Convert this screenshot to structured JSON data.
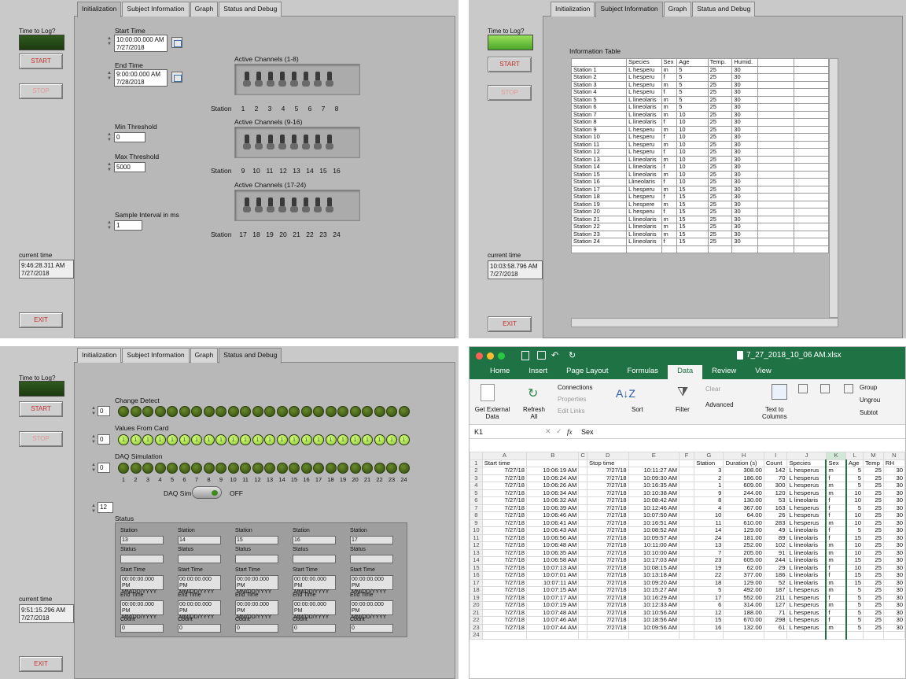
{
  "tabs": [
    "Initialization",
    "Subject Information",
    "Graph",
    "Status and Debug"
  ],
  "left": {
    "time_to_log": "Time to Log?",
    "start": "START",
    "stop": "STOP",
    "exit": "EXIT",
    "current_time_label": "current time"
  },
  "panel1": {
    "current_time": "9:46:28.311 AM\n7/27/2018",
    "start_time_label": "Start Time",
    "start_time": "10:00:00.000 AM\n7/27/2018",
    "end_time_label": "End Time",
    "end_time": "9:00:00.000 AM\n7/28/2018",
    "min_threshold_label": "Min Threshold",
    "min_threshold": "0",
    "max_threshold_label": "Max Threshold",
    "max_threshold": "5000",
    "sample_interval_label": "Sample Interval in ms",
    "sample_interval": "1",
    "channels": [
      {
        "label": "Active Channels (1-8)",
        "stations": [
          "Station",
          "1",
          "2",
          "3",
          "4",
          "5",
          "6",
          "7",
          "8"
        ]
      },
      {
        "label": "Active Channels (9-16)",
        "stations": [
          "Station",
          "9",
          "10",
          "11",
          "12",
          "13",
          "14",
          "15",
          "16"
        ]
      },
      {
        "label": "Active Channels (17-24)",
        "stations": [
          "Station",
          "17",
          "18",
          "19",
          "20",
          "21",
          "22",
          "23",
          "24"
        ]
      }
    ]
  },
  "panel2": {
    "current_time": "10:03:58.796 AM\n7/27/2018",
    "table_label": "Information Table",
    "headers": [
      "",
      "Species",
      "Sex",
      "Age",
      "Temp.",
      "Humid.",
      "",
      ""
    ],
    "rows": [
      [
        "Station 1",
        "L hesperu",
        "m",
        "5",
        "25",
        "30"
      ],
      [
        "Station 2",
        "L hesperu",
        "f",
        "5",
        "25",
        "30"
      ],
      [
        "Station 3",
        "L hesperu",
        "m",
        "5",
        "25",
        "30"
      ],
      [
        "Station 4",
        "L hesperu",
        "f",
        "5",
        "25",
        "30"
      ],
      [
        "Station 5",
        "L lineolaris",
        "m",
        "5",
        "25",
        "30"
      ],
      [
        "Station 6",
        "L lineolaris",
        "m",
        "5",
        "25",
        "30"
      ],
      [
        "Station 7",
        "L lineolaris",
        "m",
        "10",
        "25",
        "30"
      ],
      [
        "Station 8",
        "L lineolaris",
        "f",
        "10",
        "25",
        "30"
      ],
      [
        "Station 9",
        "L hesperu",
        "m",
        "10",
        "25",
        "30"
      ],
      [
        "Station 10",
        "L hesperu",
        "f",
        "10",
        "25",
        "30"
      ],
      [
        "Station 11",
        "L hesperu",
        "m",
        "10",
        "25",
        "30"
      ],
      [
        "Station 12",
        "L hesperu",
        "f",
        "10",
        "25",
        "30"
      ],
      [
        "Station 13",
        "L lineolaris",
        "m",
        "10",
        "25",
        "30"
      ],
      [
        "Station 14",
        "L lineolaris",
        "f",
        "10",
        "25",
        "30"
      ],
      [
        "Station 15",
        "L lineolaris",
        "m",
        "10",
        "25",
        "30"
      ],
      [
        "Station 16",
        "Llineolaris",
        "f",
        "10",
        "25",
        "30"
      ],
      [
        "Station 17",
        "L hesperu",
        "m",
        "15",
        "25",
        "30"
      ],
      [
        "Station 18",
        "L hesperu",
        "f",
        "15",
        "25",
        "30"
      ],
      [
        "Station 19",
        "L hespere",
        "m",
        "15",
        "25",
        "30"
      ],
      [
        "Station 20",
        "L hesperu",
        "f",
        "15",
        "25",
        "30"
      ],
      [
        "Station 21",
        "L lineolaris",
        "m",
        "15",
        "25",
        "30"
      ],
      [
        "Station 22",
        "L lineolaris",
        "m",
        "15",
        "25",
        "30"
      ],
      [
        "Station 23",
        "L lineolaris",
        "m",
        "15",
        "25",
        "30"
      ],
      [
        "Station 24",
        "L lineolaris",
        "f",
        "15",
        "25",
        "30"
      ]
    ]
  },
  "panel3": {
    "current_time": "9:51:15.296 AM\n7/27/2018",
    "change_detect_label": "Change Detect",
    "change_detect_value": "0",
    "values_from_card_label": "Values From Card",
    "values_from_card_value": "0",
    "daq_sim_label": "DAQ Simulation",
    "daq_sim_value": "0",
    "led_numbers": [
      "1",
      "2",
      "3",
      "4",
      "5",
      "6",
      "7",
      "8",
      "9",
      "10",
      "11",
      "12",
      "13",
      "14",
      "15",
      "16",
      "17",
      "18",
      "19",
      "20",
      "21",
      "22",
      "23",
      "24"
    ],
    "daq_sim_toggle_label": "DAQ Sim",
    "daq_sim_toggle_state": "OFF",
    "status_index": "12",
    "status_label": "Status",
    "station_label": "Station",
    "station_status_label": "Status",
    "start_time_label": "Start Time",
    "end_time_label": "End Time",
    "count_label": "Count",
    "time_value": "00:00:00.000 PM\nMM/DD/YYYY",
    "count_value": "0",
    "stations": [
      "13",
      "14",
      "15",
      "16",
      "17"
    ]
  },
  "excel": {
    "filename": "7_27_2018_10_06 AM.xlsx",
    "tabs": [
      "Home",
      "Insert",
      "Page Layout",
      "Formulas",
      "Data",
      "Review",
      "View"
    ],
    "active_tab": "Data",
    "ribbon": {
      "get_external": "Get External\nData",
      "refresh": "Refresh\nAll",
      "connections": "Connections",
      "properties": "Properties",
      "edit_links": "Edit Links",
      "sort": "Sort",
      "filter": "Filter",
      "clear": "Clear",
      "advanced": "Advanced",
      "text_to_columns": "Text to\nColumns",
      "group": "Group",
      "ungroup": "Ungrou",
      "subtotal": "Subtot"
    },
    "name_box": "K1",
    "formula": "Sex",
    "fx": "fx",
    "columns": [
      "",
      "A",
      "B",
      "C",
      "D",
      "E",
      "F",
      "G",
      "H",
      "I",
      "J",
      "K",
      "L",
      "M",
      "N"
    ],
    "header_row": [
      "Start time",
      "",
      "",
      "Stop time",
      "",
      "",
      "Station",
      "Duration (s)",
      "Count",
      "Species",
      "Sex",
      "Age",
      "Temp",
      "RH"
    ],
    "rows": [
      [
        "7/27/18",
        "10:06:19 AM",
        "",
        "7/27/18",
        "10:11:27 AM",
        "",
        "3",
        "308.00",
        "142",
        "L hesperus",
        "m",
        "5",
        "25",
        "30"
      ],
      [
        "7/27/18",
        "10:06:24 AM",
        "",
        "7/27/18",
        "10:09:30 AM",
        "",
        "2",
        "186.00",
        "70",
        "L hesperus",
        "f",
        "5",
        "25",
        "30"
      ],
      [
        "7/27/18",
        "10:06:26 AM",
        "",
        "7/27/18",
        "10:16:35 AM",
        "",
        "1",
        "609.00",
        "300",
        "L hesperus",
        "m",
        "5",
        "25",
        "30"
      ],
      [
        "7/27/18",
        "10:06:34 AM",
        "",
        "7/27/18",
        "10:10:38 AM",
        "",
        "9",
        "244.00",
        "120",
        "L hesperus",
        "m",
        "10",
        "25",
        "30"
      ],
      [
        "7/27/18",
        "10:06:32 AM",
        "",
        "7/27/18",
        "10:08:42 AM",
        "",
        "8",
        "130.00",
        "53",
        "L lineolaris",
        "f",
        "10",
        "25",
        "30"
      ],
      [
        "7/27/18",
        "10:06:39 AM",
        "",
        "7/27/18",
        "10:12:46 AM",
        "",
        "4",
        "367.00",
        "163",
        "L hesperus",
        "f",
        "5",
        "25",
        "30"
      ],
      [
        "7/27/18",
        "10:06:46 AM",
        "",
        "7/27/18",
        "10:07:50 AM",
        "",
        "10",
        "64.00",
        "26",
        "L hesperus",
        "f",
        "10",
        "25",
        "30"
      ],
      [
        "7/27/18",
        "10:06:41 AM",
        "",
        "7/27/18",
        "10:16:51 AM",
        "",
        "11",
        "610.00",
        "283",
        "L hesperus",
        "m",
        "10",
        "25",
        "30"
      ],
      [
        "7/27/18",
        "10:06:43 AM",
        "",
        "7/27/18",
        "10:08:52 AM",
        "",
        "14",
        "129.00",
        "49",
        "L lineolaris",
        "f",
        "5",
        "25",
        "30"
      ],
      [
        "7/27/18",
        "10:06:56 AM",
        "",
        "7/27/18",
        "10:09:57 AM",
        "",
        "24",
        "181.00",
        "89",
        "L lineolaris",
        "f",
        "15",
        "25",
        "30"
      ],
      [
        "7/27/18",
        "10:06:48 AM",
        "",
        "7/27/18",
        "10:11:00 AM",
        "",
        "13",
        "252.00",
        "102",
        "L lineolaris",
        "m",
        "10",
        "25",
        "30"
      ],
      [
        "7/27/18",
        "10:06:35 AM",
        "",
        "7/27/18",
        "10:10:00 AM",
        "",
        "7",
        "205.00",
        "91",
        "L lineolaris",
        "m",
        "10",
        "25",
        "30"
      ],
      [
        "7/27/18",
        "10:06:58 AM",
        "",
        "7/27/18",
        "10:17:03 AM",
        "",
        "23",
        "605.00",
        "244",
        "L lineolaris",
        "m",
        "15",
        "25",
        "30"
      ],
      [
        "7/27/18",
        "10:07:13 AM",
        "",
        "7/27/18",
        "10:08:15 AM",
        "",
        "19",
        "62.00",
        "29",
        "L lineolaris",
        "f",
        "10",
        "25",
        "30"
      ],
      [
        "7/27/18",
        "10:07:01 AM",
        "",
        "7/27/18",
        "10:13:18 AM",
        "",
        "22",
        "377.00",
        "186",
        "L lineolaris",
        "f",
        "15",
        "25",
        "30"
      ],
      [
        "7/27/18",
        "10:07:11 AM",
        "",
        "7/27/18",
        "10:09:20 AM",
        "",
        "18",
        "129.00",
        "52",
        "L lineolaris",
        "m",
        "15",
        "25",
        "30"
      ],
      [
        "7/27/18",
        "10:07:15 AM",
        "",
        "7/27/18",
        "10:15:27 AM",
        "",
        "5",
        "492.00",
        "187",
        "L hesperus",
        "m",
        "5",
        "25",
        "30"
      ],
      [
        "7/27/18",
        "10:07:17 AM",
        "",
        "7/27/18",
        "10:16:29 AM",
        "",
        "17",
        "552.00",
        "211",
        "L hesperus",
        "f",
        "5",
        "25",
        "30"
      ],
      [
        "7/27/18",
        "10:07:19 AM",
        "",
        "7/27/18",
        "10:12:33 AM",
        "",
        "6",
        "314.00",
        "127",
        "L hesperus",
        "m",
        "5",
        "25",
        "30"
      ],
      [
        "7/27/18",
        "10:07:48 AM",
        "",
        "7/27/18",
        "10:10:56 AM",
        "",
        "12",
        "188.00",
        "71",
        "L hesperus",
        "f",
        "5",
        "25",
        "30"
      ],
      [
        "7/27/18",
        "10:07:46 AM",
        "",
        "7/27/18",
        "10:18:56 AM",
        "",
        "15",
        "670.00",
        "298",
        "L hesperus",
        "f",
        "5",
        "25",
        "30"
      ],
      [
        "7/27/18",
        "10:07:44 AM",
        "",
        "7/27/18",
        "10:09:56 AM",
        "",
        "16",
        "132.00",
        "61",
        "L hesperus",
        "m",
        "5",
        "25",
        "30"
      ]
    ]
  }
}
